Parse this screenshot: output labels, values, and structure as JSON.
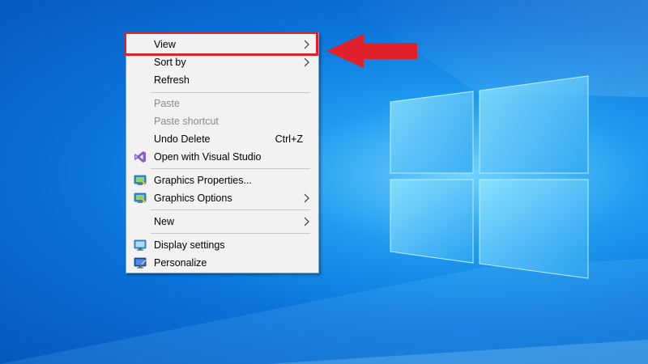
{
  "context_menu": {
    "items": [
      {
        "label": "View",
        "has_submenu": true
      },
      {
        "label": "Sort by",
        "has_submenu": true
      },
      {
        "label": "Refresh"
      },
      {
        "label": "Paste",
        "disabled": true
      },
      {
        "label": "Paste shortcut",
        "disabled": true
      },
      {
        "label": "Undo Delete",
        "shortcut": "Ctrl+Z"
      },
      {
        "label": "Open with Visual Studio",
        "icon": "visual-studio-icon"
      },
      {
        "label": "Graphics Properties...",
        "icon": "graphics-properties-icon"
      },
      {
        "label": "Graphics Options",
        "icon": "graphics-options-icon",
        "has_submenu": true
      },
      {
        "label": "New",
        "has_submenu": true
      },
      {
        "label": "Display settings",
        "icon": "display-settings-icon"
      },
      {
        "label": "Personalize",
        "icon": "personalize-icon"
      }
    ]
  },
  "annotation": {
    "highlight_color": "#e0202a",
    "highlighted_item": "View",
    "pointer": "red-arrow-left"
  },
  "colors": {
    "menu_background": "#f2f2f2",
    "disabled_text": "#8a8a8a",
    "wallpaper_base": "#0a73d9"
  }
}
